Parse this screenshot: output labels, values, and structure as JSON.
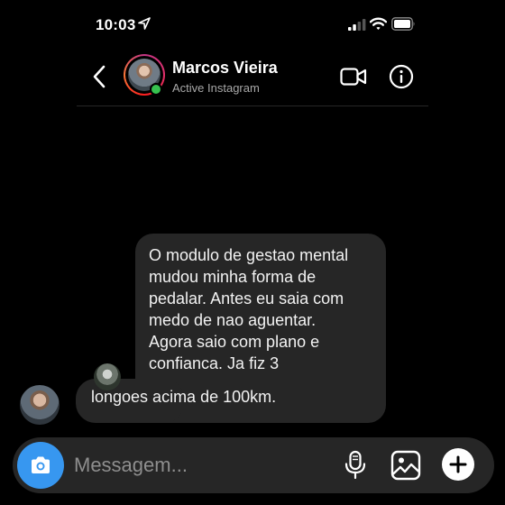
{
  "status_bar": {
    "time": "10:03",
    "icons": [
      "location-arrow-icon",
      "cellular-signal-icon",
      "wifi-icon",
      "battery-icon"
    ]
  },
  "header": {
    "contact_name": "Marcos Vieira",
    "contact_status": "Active Instagram",
    "icons": [
      "chevron-left-icon",
      "video-call-icon",
      "info-icon"
    ]
  },
  "messages": [
    {
      "lines": [
        "O modulo de gestao mental",
        "mudou minha forma de",
        "pedalar. Antes eu saia com",
        "medo de nao aguentar.",
        "Agora saio com plano e",
        "confianca. Ja fiz 3"
      ],
      "last_line": "longoes acima de 100km."
    }
  ],
  "composer": {
    "placeholder": "Messagem...",
    "icons": [
      "camera-icon",
      "microphone-icon",
      "gallery-icon",
      "plus-icon"
    ]
  },
  "colors": {
    "background": "#000000",
    "bubble": "#262626",
    "accent": "#3797f0",
    "online": "#37c24f",
    "muted_text": "#a8a8a8"
  }
}
